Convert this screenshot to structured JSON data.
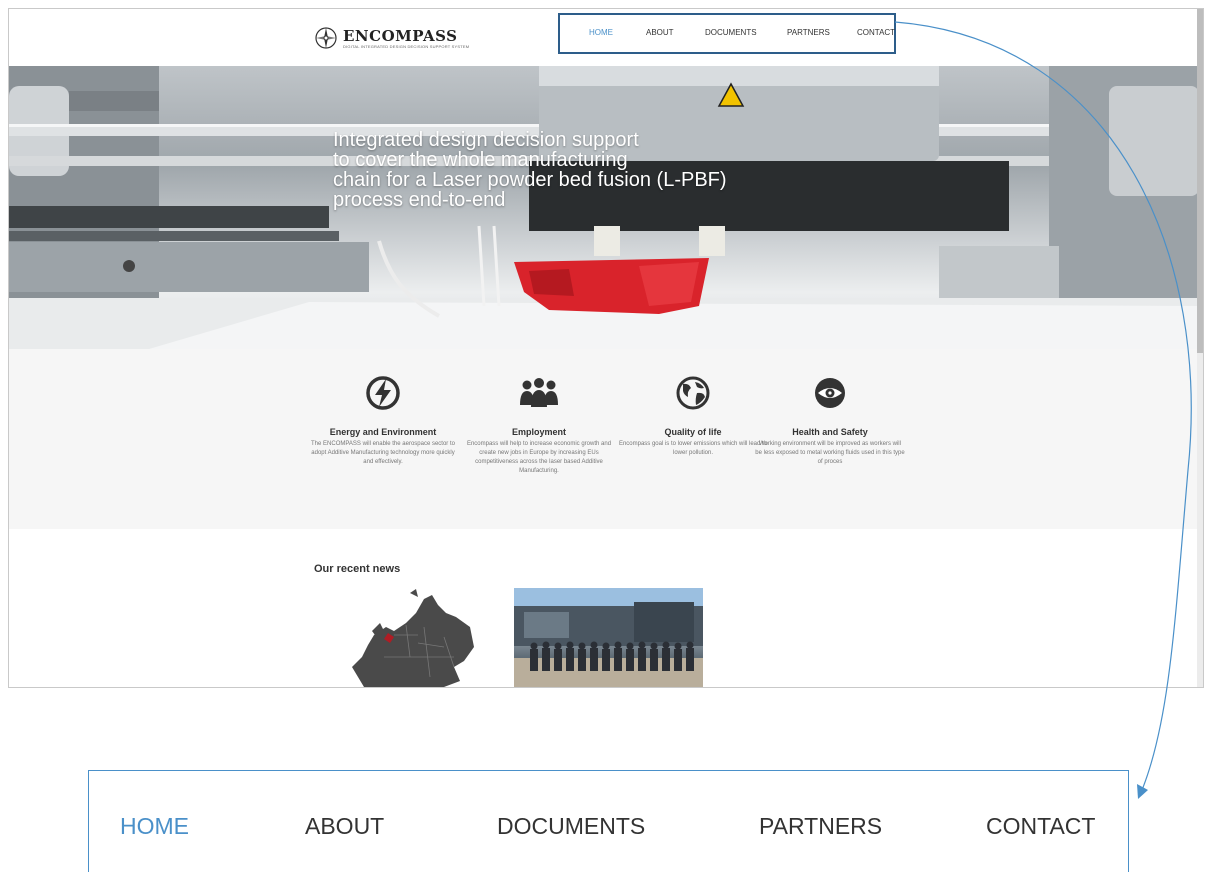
{
  "nav": {
    "items": [
      {
        "label": "HOME",
        "active": true
      },
      {
        "label": "ABOUT"
      },
      {
        "label": "DOCUMENTS"
      },
      {
        "label": "PARTNERS"
      },
      {
        "label": "CONTACT"
      }
    ]
  },
  "logo": {
    "title": "ENCOMPASS",
    "tagline": "DIGITAL INTEGRATED DESIGN DECISION SUPPORT SYSTEM"
  },
  "hero": {
    "line1": "Integrated design decision support",
    "line2": "to cover the whole manufacturing",
    "line3": "chain for a Laser powder bed fusion (L-PBF)",
    "line4": "process end-to-end"
  },
  "features": [
    {
      "icon": "lightning-icon",
      "title": "Energy and Environment",
      "text": "The ENCOMPASS will enable the aerospace sector to adopt Additive Manufacturing technology more quickly and effectively."
    },
    {
      "icon": "people-icon",
      "title": "Employment",
      "text": "Encompass will help to increase economic growth and create new jobs in Europe by increasing EUs competitiveness across the laser based Additive Manufacturing."
    },
    {
      "icon": "globe-icon",
      "title": "Quality of life",
      "text": "Encompass goal is to lower emissions which will lead to lower pollution."
    },
    {
      "icon": "eye-icon",
      "title": "Health and Safety",
      "text": "Working environment will be improved as workers will be less exposed to metal working fluids used in this type of proces"
    }
  ],
  "news": {
    "title": "Our recent news"
  },
  "colors": {
    "accent": "#4a90c9",
    "highlight_border": "#2d5d8a",
    "hero_text": "#ffffff"
  }
}
